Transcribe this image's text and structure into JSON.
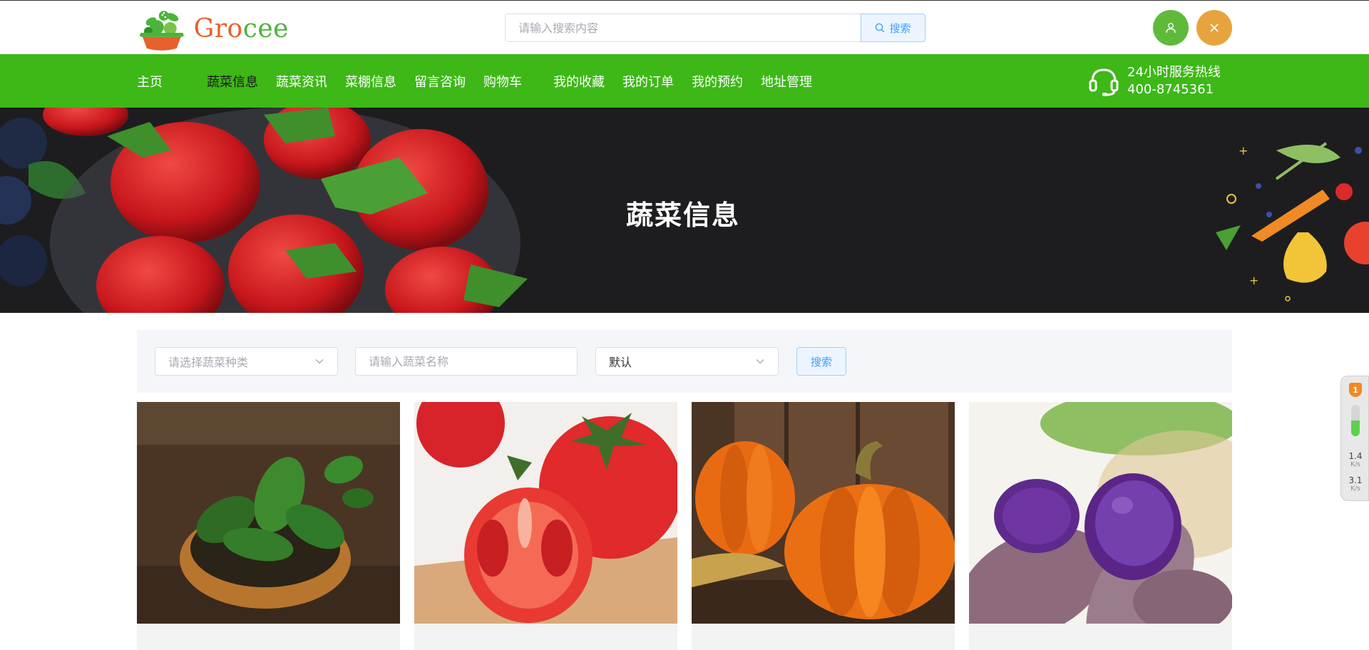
{
  "header": {
    "logo_text": "Grocee",
    "search_placeholder": "请输入搜索内容",
    "search_button": "搜索",
    "user_icon": "user-icon",
    "close_icon": "close-icon"
  },
  "nav": {
    "items": [
      {
        "label": "主页",
        "active": false
      },
      {
        "label": "蔬菜信息",
        "active": true
      },
      {
        "label": "蔬菜资讯",
        "active": false
      },
      {
        "label": "菜棚信息",
        "active": false
      },
      {
        "label": "留言咨询",
        "active": false
      },
      {
        "label": "购物车",
        "active": false
      },
      {
        "label": "我的收藏",
        "active": false
      },
      {
        "label": "我的订单",
        "active": false
      },
      {
        "label": "我的预约",
        "active": false
      },
      {
        "label": "地址管理",
        "active": false
      }
    ],
    "hotline": {
      "title": "24小时服务热线",
      "number": "400-8745361",
      "icon": "headset-icon"
    }
  },
  "banner": {
    "title": "蔬菜信息"
  },
  "filter": {
    "category_placeholder": "请选择蔬菜种类",
    "name_placeholder": "请输入蔬菜名称",
    "sort_value": "默认",
    "search_button": "搜索"
  },
  "cards": [
    {
      "image": "spinach-image"
    },
    {
      "image": "tomato-image"
    },
    {
      "image": "pumpkin-image"
    },
    {
      "image": "purple-sweet-potato-image"
    }
  ],
  "side_widget": {
    "badge": "1",
    "upload_speed": "1.4",
    "download_speed": "3.1",
    "unit": "K/s"
  },
  "colors": {
    "nav_green": "#3db817",
    "user_button": "#5fba3b",
    "close_button": "#e7a43e",
    "accent_blue": "#409eff"
  }
}
